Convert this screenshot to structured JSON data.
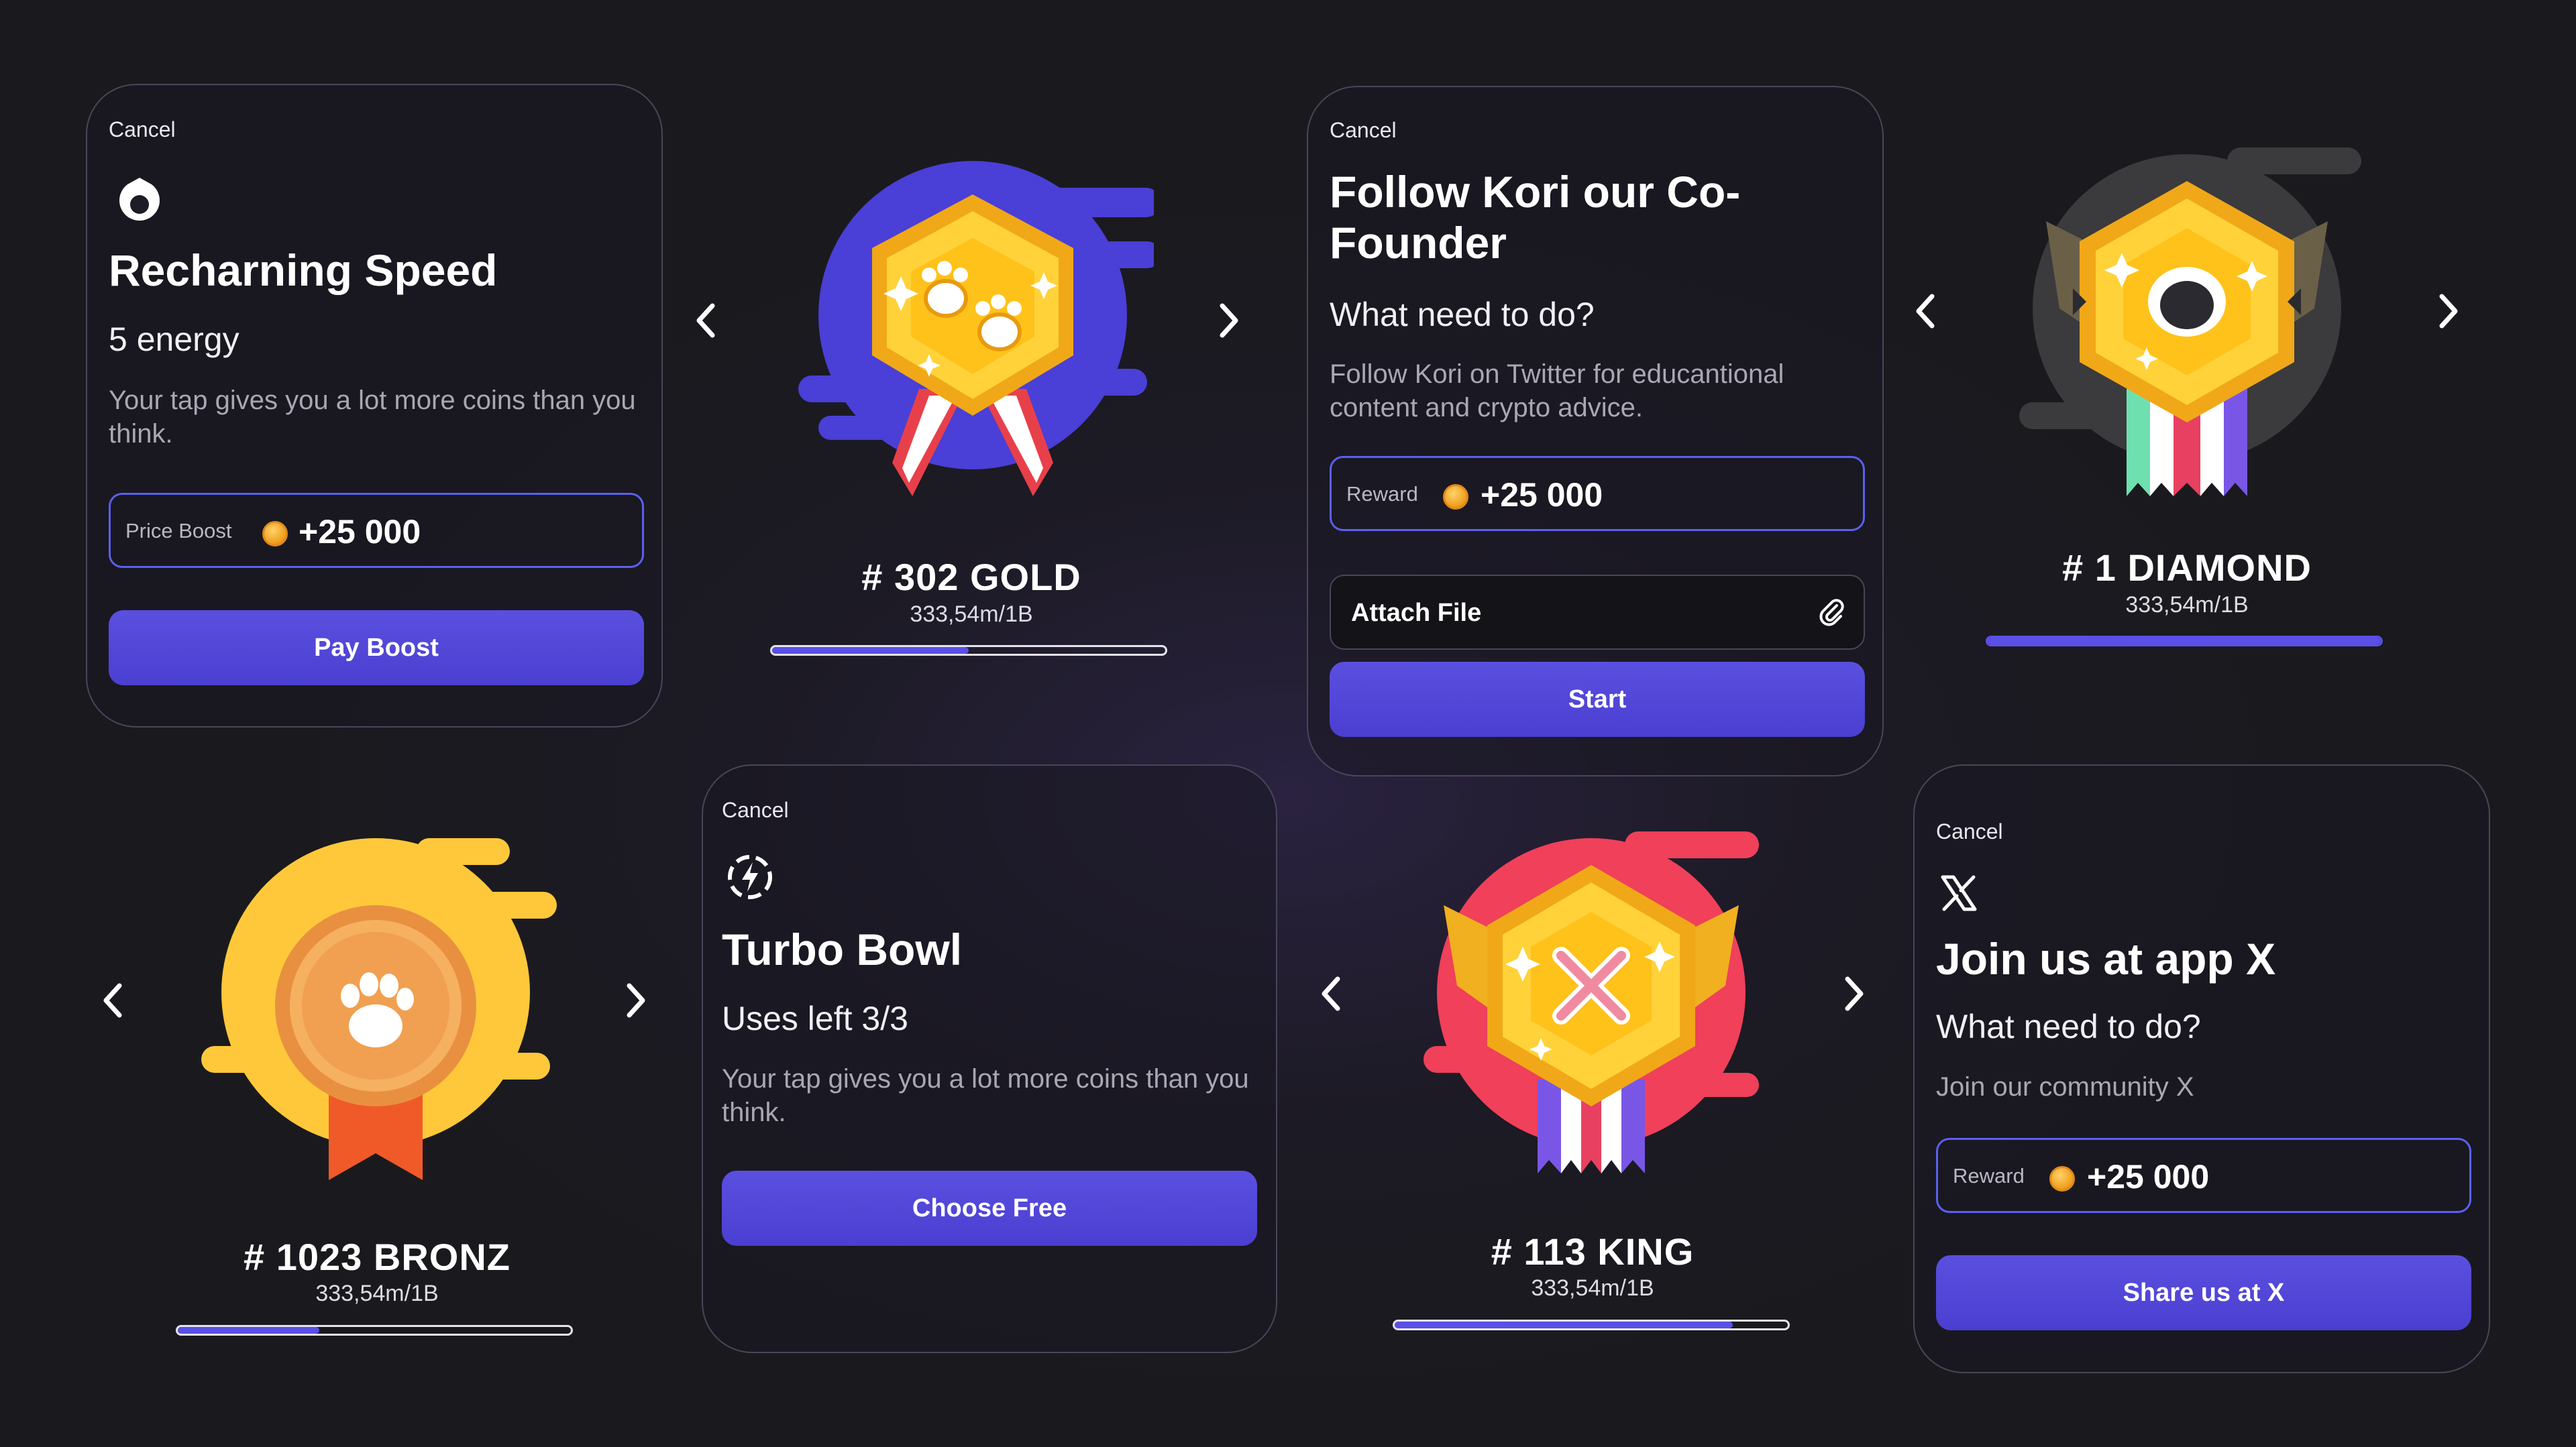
{
  "recharging": {
    "cancel": "Cancel",
    "icon": "droplet-icon",
    "title": "Recharning Speed",
    "subtitle": "5 energy",
    "description": "Your tap gives you a lot more coins than you think.",
    "field_label": "Price Boost",
    "field_value": "+25 000",
    "button": "Pay Boost"
  },
  "follow": {
    "cancel": "Cancel",
    "title": "Follow Kori our Co-Founder",
    "subtitle": "What need to do?",
    "description": "Follow Kori on Twitter for educantional content and crypto advice.",
    "field_label": "Reward",
    "field_value": "+25 000",
    "attach_label": "Attach File",
    "button": "Start"
  },
  "turbo": {
    "cancel": "Cancel",
    "icon": "lightning-icon",
    "title": "Turbo Bowl",
    "subtitle": "Uses left 3/3",
    "description": "Your tap gives you a lot more coins than you think.",
    "button": "Choose Free"
  },
  "joinx": {
    "cancel": "Cancel",
    "icon": "x-logo-icon",
    "title": "Join us at app X",
    "subtitle": "What need to do?",
    "description": "Join our community X",
    "field_label": "Reward",
    "field_value": "+25 000",
    "button": "Share us at X"
  },
  "badges": {
    "gold": {
      "rank": "# 302 GOLD",
      "score": "333,54m/1B",
      "progress": 0.5,
      "icon": "paw-prints-icon"
    },
    "diamond": {
      "rank": "# 1 DIAMOND",
      "score": "333,54m/1B",
      "progress": 1.0,
      "icon": "gem-icon"
    },
    "bronz": {
      "rank": "# 1023 BRONZ",
      "score": "333,54m/1B",
      "progress": 0.36,
      "icon": "paw-icon"
    },
    "king": {
      "rank": "# 113 KING",
      "score": "333,54m/1B",
      "progress": 0.86,
      "icon": "bone-icon"
    }
  },
  "colors": {
    "accent": "#5a4fe6",
    "field_border": "#5b60f0",
    "background": "#1a1a1e",
    "coin": "#f0a020"
  }
}
